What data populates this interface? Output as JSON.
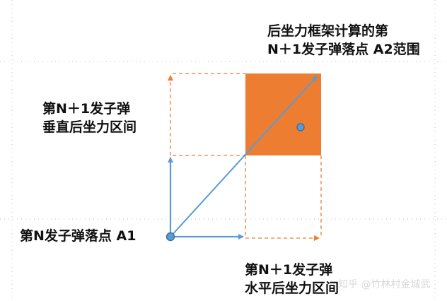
{
  "labels": {
    "a2_range": {
      "line1": "后坐力框架计算的第",
      "line2": "N＋1发子弹落点 A2范围"
    },
    "vertical_recoil": {
      "line1": "第N＋1发子弹",
      "line2": "垂直后坐力区间"
    },
    "point_a1": "第N发子弹落点 A1",
    "horizontal_recoil": {
      "line1": "第N＋1发子弹",
      "line2": "水平后坐力区间"
    }
  },
  "watermark": "知乎 @竹林村金城武",
  "colors": {
    "blue": "#5b9bd5",
    "orange": "#ed7d31",
    "grid": "#bfbfbf"
  }
}
